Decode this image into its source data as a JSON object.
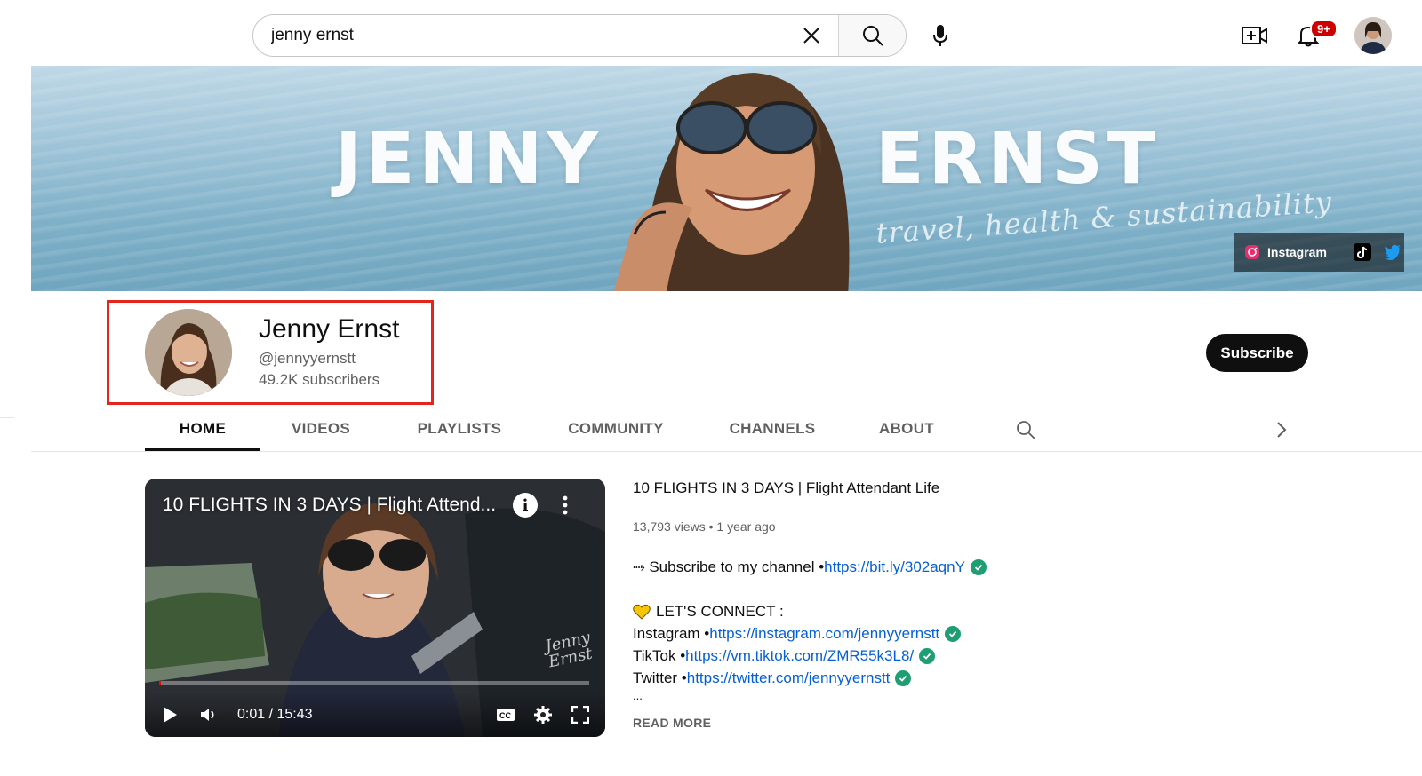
{
  "search": {
    "value": "jenny ernst",
    "placeholder": "Search"
  },
  "masthead": {
    "notification_count": "9+"
  },
  "banner": {
    "word_left": "JENNY",
    "word_right": "ERNST",
    "tagline": "travel, health & sustainability",
    "links": {
      "instagram_label": "Instagram",
      "colors": {
        "instagram": "#e1306c",
        "twitter": "#1d9bf0"
      }
    }
  },
  "channel": {
    "name": "Jenny Ernst",
    "handle": "@jennyyernstt",
    "subscribers": "49.2K subscribers",
    "subscribe_label": "Subscribe"
  },
  "tabs": [
    {
      "label": "HOME",
      "active": true
    },
    {
      "label": "VIDEOS"
    },
    {
      "label": "PLAYLISTS"
    },
    {
      "label": "COMMUNITY"
    },
    {
      "label": "CHANNELS"
    },
    {
      "label": "ABOUT"
    }
  ],
  "featured": {
    "player_title": "10 FLIGHTS IN 3 DAYS | Flight Attend...",
    "time": "0:01 / 15:43",
    "progress": 0.004,
    "watermark": "Jenny Ernst",
    "title": "10 FLIGHTS IN 3 DAYS | Flight Attendant Life",
    "views": "13,793 views",
    "age": "1 year ago",
    "description": {
      "subscribe_prefix": "⤑ Subscribe to my channel • ",
      "subscribe_link": "https://bit.ly/302aqnY",
      "connect_heading": "LET'S CONNECT :",
      "instagram_prefix": "Instagram • ",
      "instagram_link": "https://instagram.com/jennyyernstt",
      "tiktok_prefix": "TikTok • ",
      "tiktok_link": "https://vm.tiktok.com/ZMR55k3L8/",
      "twitter_prefix": "Twitter • ",
      "twitter_link": "https://twitter.com/jennyyernstt",
      "ellipsis": "..."
    },
    "read_more": "READ MORE"
  },
  "colors": {
    "accent_link": "#065fd4",
    "highlight_box": "#e3251c",
    "verified_check": "#1f9e74",
    "heart": "#f7c600"
  }
}
